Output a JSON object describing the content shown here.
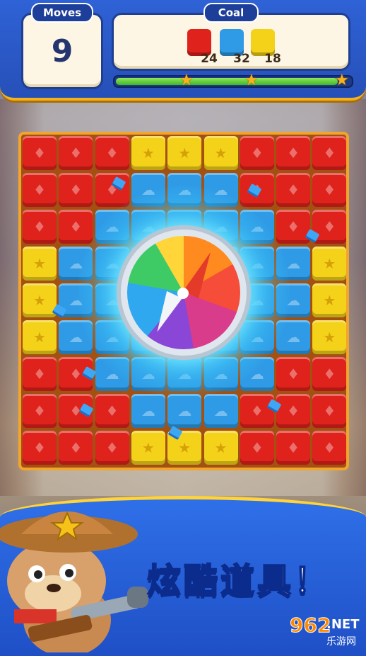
{
  "hud": {
    "moves_label": "Moves",
    "moves_value": "9",
    "coal_label": "Coal",
    "goals": [
      {
        "color": "#e0221c",
        "count": "24",
        "icon": "fire-icon"
      },
      {
        "color": "#2f9be6",
        "count": "32",
        "icon": "cloud-icon"
      },
      {
        "color": "#f4d21a",
        "count": "18",
        "icon": "star-icon"
      }
    ],
    "progress_fraction": 0.95,
    "star_count": 3
  },
  "board": {
    "rows": [
      "rrryyyrrr",
      "rrrbbbrrr",
      "rrbbbbbrr",
      "ybbbbbbby",
      "ybbbbbbby",
      "ybbbbbbby",
      "rrbbbbbrr",
      "rrrbbbrrr",
      "rrryyyrrr"
    ],
    "colors": {
      "r": "#e0221c",
      "b": "#2f9be6",
      "y": "#f4d21a"
    },
    "booster": "compass-icon"
  },
  "promo": {
    "headline": "炫酷道具！"
  },
  "watermark": {
    "brand": "962",
    "suffix": ".NET",
    "subtitle": "乐游网"
  }
}
